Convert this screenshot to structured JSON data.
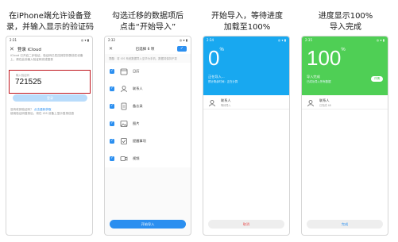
{
  "captions": {
    "step1": [
      "在iPhone端允许设备登",
      "录，并输入显示的验证码"
    ],
    "step2": [
      "勾选迁移的数据项后",
      "点击“开始导入”"
    ],
    "step3": [
      "开始导入，等待进度",
      "加载至100%"
    ],
    "step4": [
      "进度显示100%",
      "导入完成"
    ]
  },
  "phone1": {
    "time": "2:31",
    "status_right": "◎ ▾ ▮",
    "title": "登录 iCloud",
    "info": "iCloud 已开启二步验证，验证码已发送到您的受信任设备上，请在此处输入验证码完成登录",
    "code_hint": "输入验证码",
    "code": "721525",
    "button": "登录",
    "foot1_label": "没有收到验证码？",
    "foot1_link": "点击重新获取",
    "foot2": "使用验证码登录后，将在 iOS 设备上显示登录信息"
  },
  "phone2": {
    "time": "2:32",
    "title": "已选择 6 项",
    "note": "提醒：将 iOS 系统数据导入至华为手机，数据将保持不变",
    "items": [
      "日历",
      "联系人",
      "备忘录",
      "图片",
      "提醒事项",
      "视频"
    ],
    "button": "开始导入"
  },
  "phone3": {
    "time": "2:34",
    "progress": "0",
    "percent_sign": "%",
    "status": "正在导入...",
    "sub": "预计剩余时间：正在计算",
    "item_name": "联系人",
    "item_sub": "等待导入",
    "button": "取消"
  },
  "phone4": {
    "time": "2:35",
    "progress": "100",
    "percent_sign": "%",
    "status": "导入完成",
    "sub": "已成功导入所有数据",
    "done_button": "详情",
    "item_name": "联系人",
    "item_sub": "已完成 48",
    "button": "完成"
  },
  "colors": {
    "accent": "#2b8ff0",
    "progress_blue": "#18a8f0",
    "success_green": "#4fcf55",
    "highlight_red": "#c0141c"
  }
}
